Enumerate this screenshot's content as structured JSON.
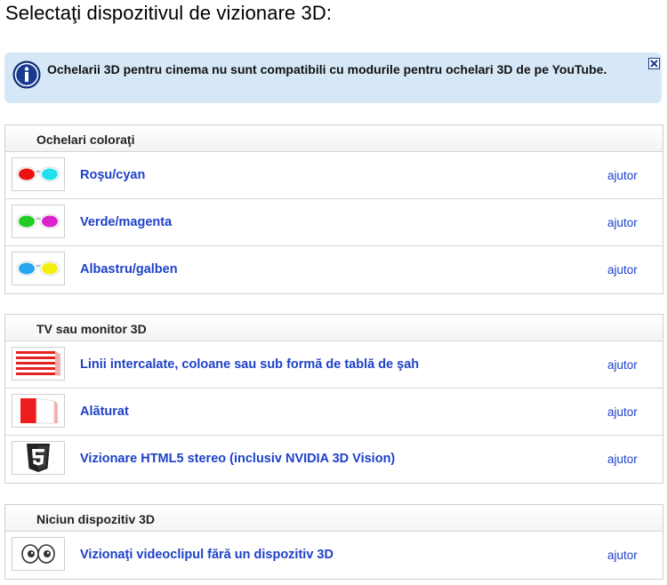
{
  "page": {
    "title": "Selectaţi dispozitivul de vizionare 3D:"
  },
  "banner": {
    "message": "Ochelarii 3D pentru cinema nu sunt compatibili cu modurile pentru ochelari 3D de pe YouTube.",
    "icon": "info-icon",
    "close_icon": "close-icon"
  },
  "groups": [
    {
      "title": "Ochelari coloraţi",
      "items": [
        {
          "label": "Roşu/cyan",
          "help": "ajutor",
          "icon": "red-cyan-glasses-icon"
        },
        {
          "label": "Verde/magenta",
          "help": "ajutor",
          "icon": "green-magenta-glasses-icon"
        },
        {
          "label": "Albastru/galben",
          "help": "ajutor",
          "icon": "blue-yellow-glasses-icon"
        }
      ]
    },
    {
      "title": "TV sau monitor 3D",
      "items": [
        {
          "label": "Linii intercalate, coloane sau sub formă de tablă de şah",
          "help": "ajutor",
          "icon": "interlaced-lines-icon"
        },
        {
          "label": "Alăturat",
          "help": "ajutor",
          "icon": "side-by-side-icon"
        },
        {
          "label": "Vizionare HTML5 stereo (inclusiv NVIDIA 3D Vision)",
          "help": "ajutor",
          "icon": "html5-icon"
        }
      ]
    },
    {
      "title": "Niciun dispozitiv 3D",
      "items": [
        {
          "label": "Vizionaţi videoclipul fără un dispozitiv 3D",
          "help": "ajutor",
          "icon": "eyes-icon"
        }
      ]
    }
  ],
  "colors": {
    "link": "#1e41c8",
    "banner_bg": "#d6e8f7",
    "info_icon": "#1a3a8f"
  }
}
